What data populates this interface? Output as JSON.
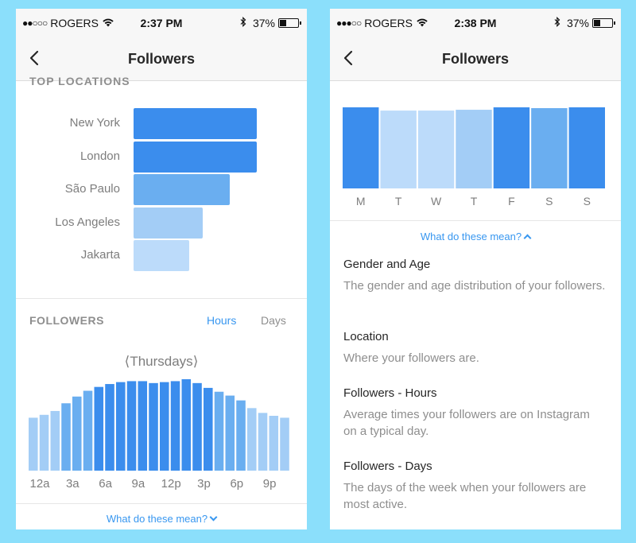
{
  "colors": {
    "background": "#8bdffb",
    "accent": "#3897f0",
    "bar_dark": "#3b8ded",
    "bar_mid": "#6aaef0",
    "bar_light": "#a3cdf6",
    "bar_lighter": "#bcdbfa"
  },
  "left_screen": {
    "status": {
      "carrier": "ROGERS",
      "signal_dots": "●●○○○",
      "time": "2:37 PM",
      "battery": "37%",
      "battery_level": 0.37
    },
    "nav": {
      "title": "Followers"
    },
    "top_locations": {
      "heading_partial": "TOP LOCATIONS",
      "items": [
        {
          "label": "New York",
          "value": 100
        },
        {
          "label": "London",
          "value": 100
        },
        {
          "label": "São Paulo",
          "value": 78
        },
        {
          "label": "Los Angeles",
          "value": 56
        },
        {
          "label": "Jakarta",
          "value": 45
        }
      ]
    },
    "followers_section": {
      "heading": "FOLLOWERS",
      "tab_hours": "Hours",
      "tab_days": "Days",
      "day": "Thursdays",
      "prev_arrow": "⟨",
      "next_arrow": "⟩",
      "hour_values": [
        55,
        58,
        62,
        70,
        77,
        83,
        87,
        90,
        92,
        93,
        93,
        91,
        92,
        93,
        95,
        91,
        86,
        82,
        78,
        73,
        65,
        60,
        57,
        55
      ],
      "hour_labels": [
        "12a",
        "3a",
        "6a",
        "9a",
        "12p",
        "3p",
        "6p",
        "9p"
      ]
    },
    "footer_link": "What do these mean?"
  },
  "right_screen": {
    "status": {
      "carrier": "ROGERS",
      "signal_dots": "●●●○○",
      "time": "2:38 PM",
      "battery": "37%",
      "battery_level": 0.37
    },
    "nav": {
      "title": "Followers"
    },
    "days_chart": {
      "labels": [
        "M",
        "T",
        "W",
        "T",
        "F",
        "S",
        "S"
      ],
      "values": [
        100,
        96,
        96,
        97,
        100,
        99,
        100
      ]
    },
    "link": "What do these mean?",
    "definitions": [
      {
        "title": "Gender and Age",
        "text": "The gender and age distribution of your followers."
      },
      {
        "title": "Location",
        "text": "Where your followers are."
      },
      {
        "title": "Followers - Hours",
        "text": "Average times your followers are on Instagram on a typical day."
      },
      {
        "title": "Followers - Days",
        "text": "The days of the week when your followers are most active."
      }
    ]
  }
}
